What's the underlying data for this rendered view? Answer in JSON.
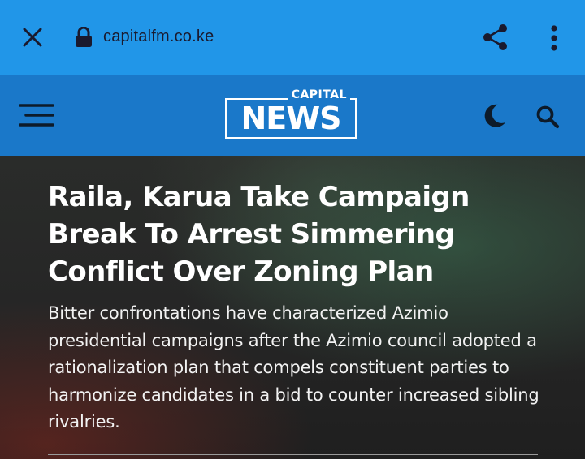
{
  "browser": {
    "url": "capitalfm.co.ke",
    "icons": {
      "close": "close-icon",
      "lock": "lock-icon",
      "share": "share-icon",
      "menu": "more-vert-icon"
    }
  },
  "site_header": {
    "logo_top": "CAPITAL",
    "logo_main": "NEWS",
    "icons": {
      "menu": "hamburger-icon",
      "theme": "moon-icon",
      "search": "search-icon"
    },
    "colors": {
      "browser_bar": "#2196e8",
      "header": "#1a78c9"
    }
  },
  "article": {
    "headline": "Raila, Karua Take Campaign Break To Arrest Simmering Conflict Over Zoning Plan",
    "summary": "Bitter confrontations have characterized Azimio presidential campaigns after the Azimio council adopted a rationalization plan that compels constituent parties to harmonize candidates in a bid to counter increased sibling rivalries."
  }
}
